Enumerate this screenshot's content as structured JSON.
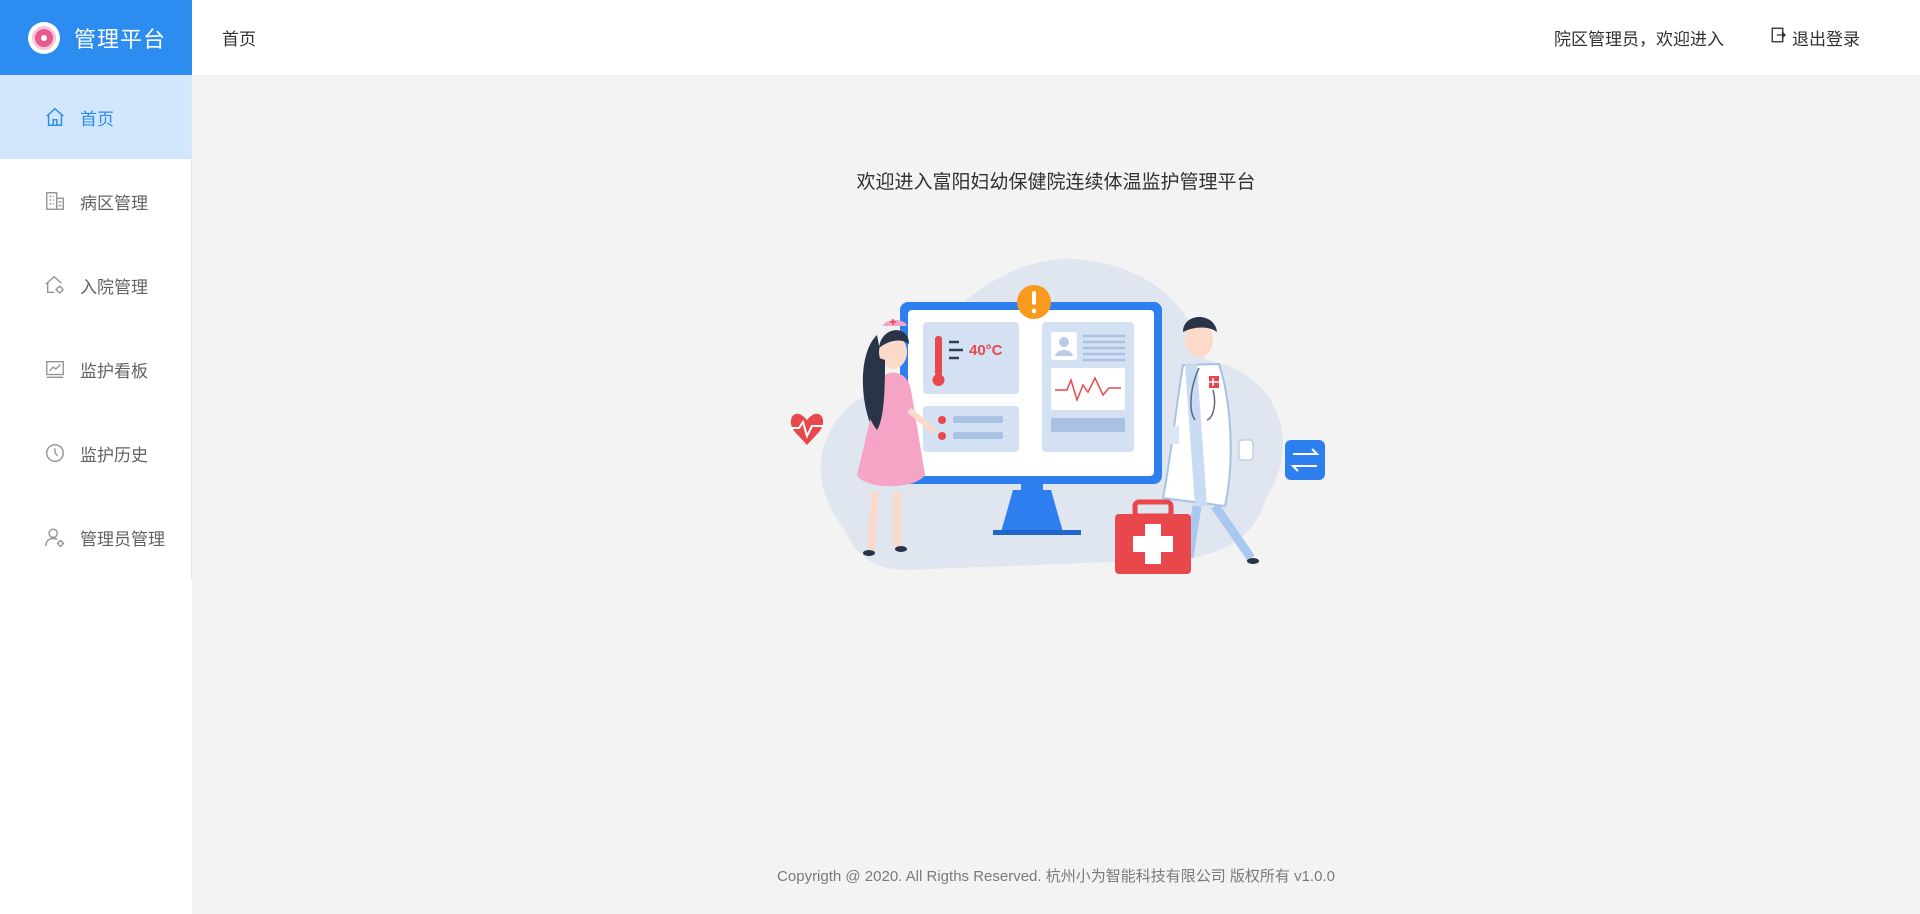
{
  "app": {
    "title": "管理平台"
  },
  "sidebar": {
    "items": [
      {
        "label": "首页",
        "icon": "home-icon",
        "active": true
      },
      {
        "label": "病区管理",
        "icon": "building-icon",
        "active": false
      },
      {
        "label": "入院管理",
        "icon": "house-gear-icon",
        "active": false
      },
      {
        "label": "监护看板",
        "icon": "chart-board-icon",
        "active": false
      },
      {
        "label": "监护历史",
        "icon": "clock-icon",
        "active": false
      },
      {
        "label": "管理员管理",
        "icon": "user-gear-icon",
        "active": false
      }
    ]
  },
  "header": {
    "breadcrumb": "首页",
    "welcome": "院区管理员，欢迎进入",
    "logout_label": "退出登录"
  },
  "main": {
    "welcome_title": "欢迎进入富阳妇幼保健院连续体温监护管理平台",
    "illustration_temp": "40°C"
  },
  "footer": {
    "copyright": "Copyrigth @ 2020. All Rigths Reserved. 杭州小为智能科技有限公司 版权所有 v1.0.0"
  },
  "colors": {
    "accent": "#2d8cf0",
    "active_bg": "#d2e7fd",
    "alert": "#e8474c"
  }
}
